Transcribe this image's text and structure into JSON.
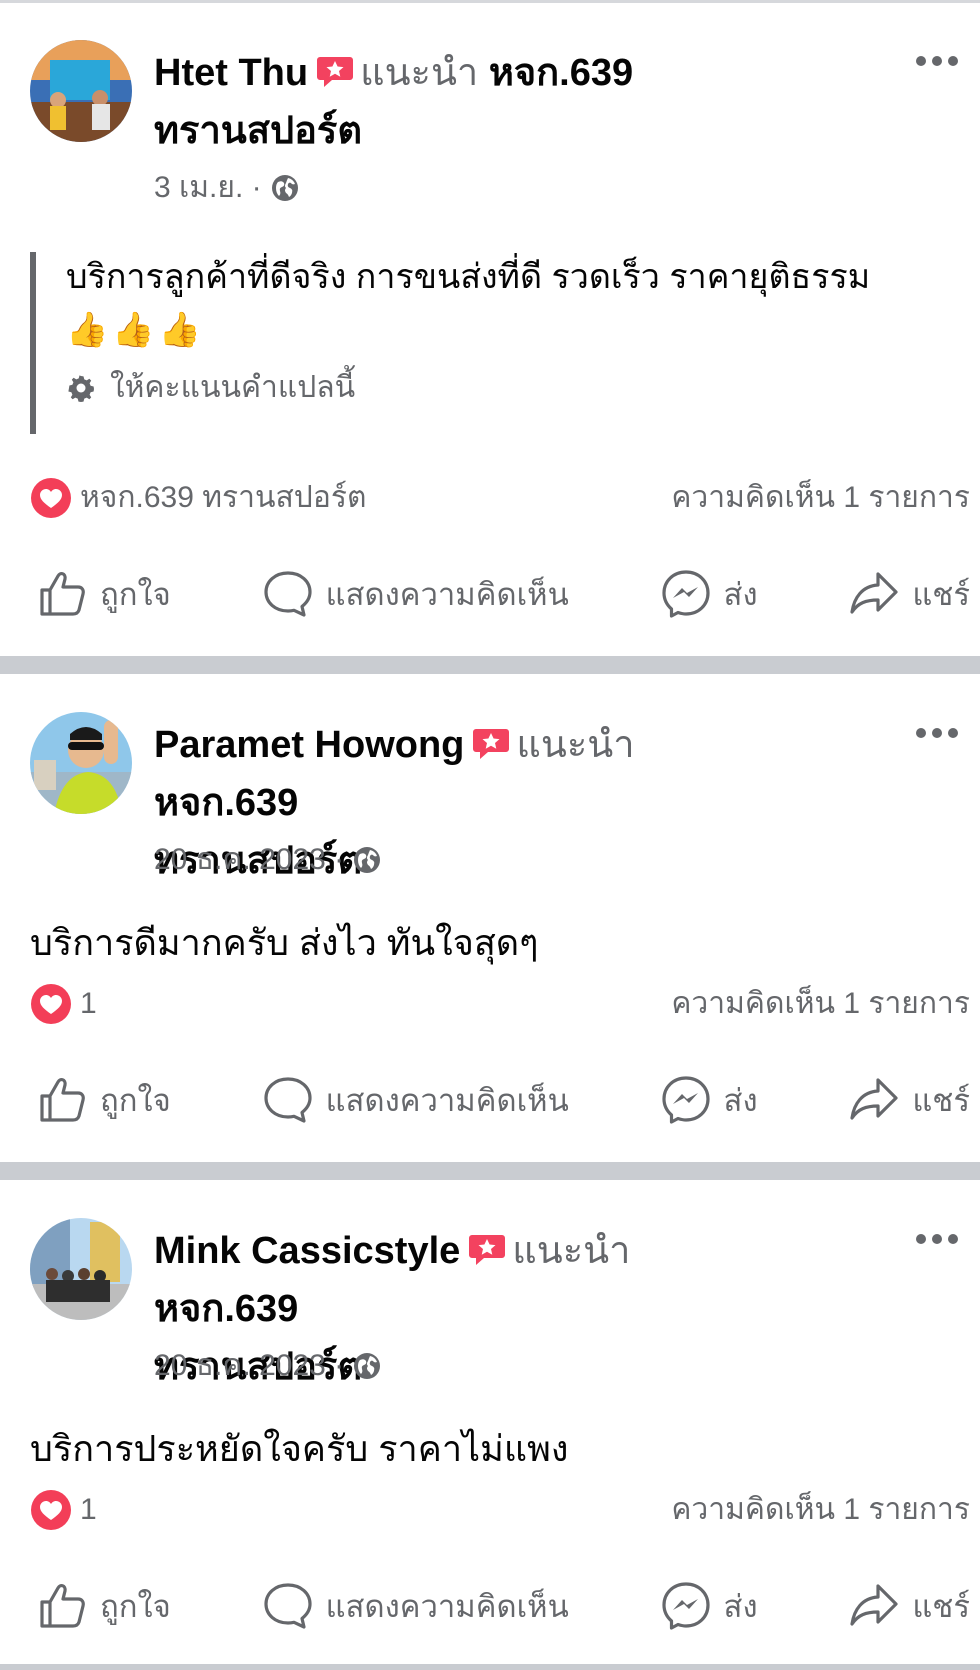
{
  "colors": {
    "secondary_text": "#65676b",
    "primary_text": "#050505",
    "heart": "#f33e58",
    "divider": "#c9ccd1"
  },
  "posts": [
    {
      "author": "Htet Thu",
      "recommends": "แนะนำ",
      "page_name_1": "หจก.639",
      "page_name_2": "ทรานสปอร์ต",
      "date": "3 เม.ย. ·",
      "text": "บริการลูกค้าที่ดีจริง การขนส่งที่ดี รวดเร็ว ราคายุติธรรม",
      "emoji": "👍👍👍",
      "rate_translation": "ให้คะแนนคำแปลนี้",
      "reaction_label": "หจก.639 ทรานสปอร์ต",
      "comment_count": "ความคิดเห็น 1 รายการ",
      "icons": {
        "badge": "recommend-star-icon",
        "visibility": "globe-icon"
      }
    },
    {
      "author": "Paramet Howong",
      "recommends": "แนะนำ",
      "page_name_1": "หจก.639",
      "page_name_2": "ทรานสปอร์ต",
      "date": "20 ธ.ค. 2023 ·",
      "text": "บริการดีมากครับ ส่งไว ทันใจสุดๆ",
      "reaction_label": "1",
      "comment_count": "ความคิดเห็น 1 รายการ"
    },
    {
      "author": "Mink Cassicstyle",
      "recommends": "แนะนำ",
      "page_name_1": "หจก.639",
      "page_name_2": "ทรานสปอร์ต",
      "date": "20 ธ.ค. 2023 ·",
      "text": "บริการประหยัดใจครับ ราคาไม่แพง",
      "reaction_label": "1",
      "comment_count": "ความคิดเห็น 1 รายการ"
    }
  ],
  "actions": {
    "like": "ถูกใจ",
    "comment": "แสดงความคิดเห็น",
    "send": "ส่ง",
    "share": "แชร์"
  }
}
